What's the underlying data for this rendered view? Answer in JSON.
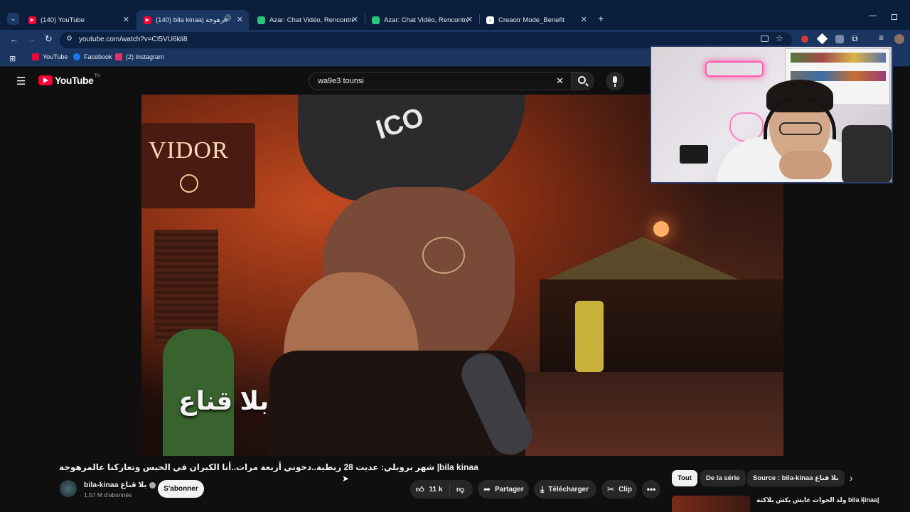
{
  "browser": {
    "tabs": [
      {
        "title": "(140) YouTube",
        "favicon": "youtube-icon",
        "color": "#ff0033"
      },
      {
        "title": "(140) bila kinaa| عالمرهوجة |...",
        "favicon": "youtube-icon",
        "color": "#ff0033",
        "active": true
      },
      {
        "title": "Azar: Chat Vidéo, Rencontrer de...",
        "favicon": "azar-icon",
        "color": "#29c77a"
      },
      {
        "title": "Azar: Chat Vidéo, Rencontrer de...",
        "favicon": "azar-icon",
        "color": "#29c77a"
      },
      {
        "title": "Creaotr Mode_Benefit",
        "favicon": "tiktok-icon",
        "color": "#ffffff"
      }
    ],
    "url": "youtube.com/watch?v=CI5VU6kli8",
    "bookmarks": [
      {
        "label": "YouTube",
        "icon": "youtube-icon",
        "color": "#ff0033"
      },
      {
        "label": "Facebook",
        "icon": "facebook-icon",
        "color": "#1877f2"
      },
      {
        "label": "(2) Instagram",
        "icon": "instagram-icon",
        "color": "#e1306c"
      }
    ]
  },
  "youtube": {
    "logo_text": "YouTube",
    "logo_region": "TN",
    "search_query": "wa9e3 tounsi",
    "video_overlay_text": "بلا قناع",
    "video_sign_text": "VIDOR",
    "video_title": "شهر بروبلي: عديت 28 ربطية..دخوني أربعة مرات..أنا الكبران في الحبس وتعاركنا عالمرهوجة |bila kinaa",
    "channel_name": "bila-kinaa بلا قناع",
    "subscribers": "1,57 M d'abonnés",
    "subscribe_label": "S'abonner",
    "likes": "11 k",
    "share_label": "Partager",
    "download_label": "Télécharger",
    "clip_label": "Clip",
    "chips": [
      "Tout",
      "De la série",
      "Source : bila-kinaa بلا قناع"
    ],
    "suggested_title": "ولد الحوات عايش بكش بلاكثة bila kinaa|"
  }
}
